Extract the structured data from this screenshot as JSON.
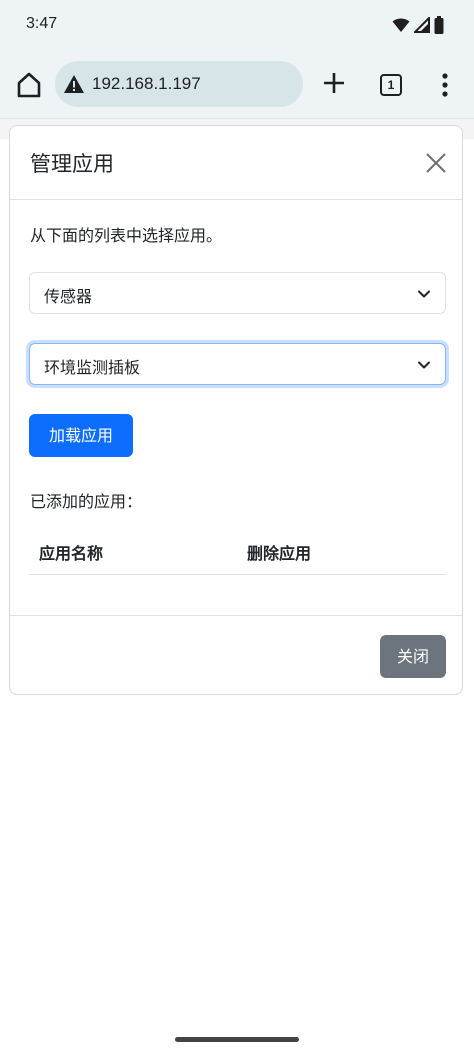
{
  "status_bar": {
    "time": "3:47",
    "icons": [
      "wifi-icon",
      "signal-icon",
      "battery-icon"
    ]
  },
  "browser": {
    "url": "192.168.1.197",
    "tab_count": "1",
    "icons": [
      "home-icon",
      "warning-icon",
      "plus-icon",
      "tab-switcher-icon",
      "more-vert-icon"
    ]
  },
  "modal": {
    "title": "管理应用",
    "instruction": "从下面的列表中选择应用。",
    "category_select": {
      "value": "传感器"
    },
    "app_select": {
      "value": "环境监测插板"
    },
    "load_button": "加载应用",
    "added_heading": "已添加的应用：",
    "table": {
      "columns": [
        "应用名称",
        "删除应用"
      ],
      "rows": []
    },
    "close_button": "关闭"
  },
  "colors": {
    "primary": "#0d6efd",
    "secondary": "#6c757d",
    "focus_ring": "#86b7fe",
    "chrome_bg": "#eef4f5",
    "url_bg": "#d7e5e9"
  }
}
